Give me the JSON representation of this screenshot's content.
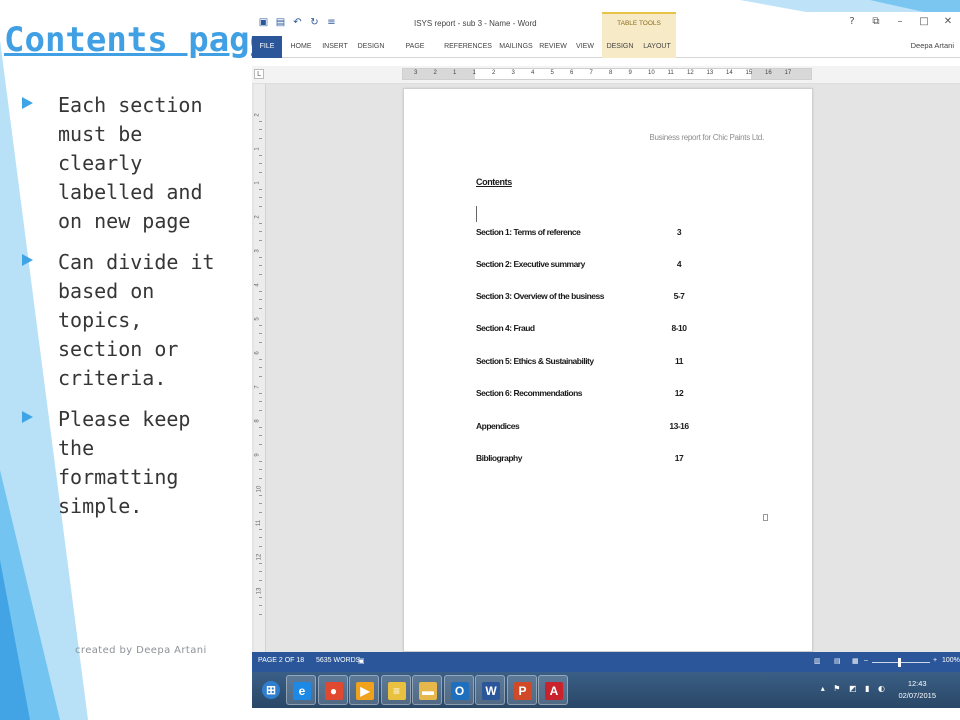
{
  "slide": {
    "title": "Contents page",
    "bullets": [
      "Each section\nmust be\nclearly\nlabelled and\non new page",
      "Can divide it\nbased on\ntopics,\nsection or\ncriteria.",
      "Please keep\nthe\nformatting\nsimple."
    ],
    "credit": "created by Deepa Artani"
  },
  "word": {
    "doc_title": "ISYS report - sub 3 - Name - Word",
    "table_tools_label": "TABLE TOOLS",
    "user_name": "Deepa Artani",
    "window_controls": [
      "?",
      "⧉",
      "–",
      "□",
      "✕"
    ],
    "tabs": [
      "FILE",
      "HOME",
      "INSERT",
      "DESIGN",
      "PAGE LAYOUT",
      "REFERENCES",
      "MAILINGS",
      "REVIEW",
      "VIEW",
      "DESIGN",
      "LAYOUT"
    ],
    "ruler_numbers": [
      "3",
      "2",
      "1",
      "1",
      "2",
      "3",
      "4",
      "5",
      "6",
      "7",
      "8",
      "9",
      "10",
      "11",
      "12",
      "13",
      "14",
      "15",
      "16",
      "17"
    ],
    "vruler_numbers": [
      "2",
      "1",
      "1",
      "2",
      "3",
      "4",
      "5",
      "6",
      "7",
      "8",
      "9",
      "10",
      "11",
      "12",
      "13"
    ],
    "page": {
      "header": "Business report for Chic Paints Ltd.",
      "contents_heading": "Contents",
      "toc": [
        {
          "label": "Section 1: Terms of reference",
          "page": "3"
        },
        {
          "label": "Section 2: Executive summary",
          "page": "4"
        },
        {
          "label": "Section 3: Overview of the business",
          "page": "5-7"
        },
        {
          "label": "Section 4: Fraud",
          "page": "8-10"
        },
        {
          "label": "Section 5: Ethics & Sustainability",
          "page": "11"
        },
        {
          "label": "Section 6: Recommendations",
          "page": "12"
        },
        {
          "label": "Appendices",
          "page": "13-16"
        },
        {
          "label": "Bibliography",
          "page": "17"
        }
      ]
    },
    "status": {
      "page_info": "PAGE 2 OF 18",
      "word_count": "5635 WORDS",
      "zoom": "100%"
    },
    "taskbar": {
      "apps": [
        {
          "name": "start",
          "glyph": "⊞",
          "color": "#2f7fd1"
        },
        {
          "name": "internet-explorer",
          "glyph": "e",
          "color": "#1e88e5"
        },
        {
          "name": "chrome",
          "glyph": "●",
          "color": "#e0492f"
        },
        {
          "name": "media-player",
          "glyph": "▶",
          "color": "#f0a21c"
        },
        {
          "name": "notes",
          "glyph": "≡",
          "color": "#e8c23e"
        },
        {
          "name": "folder",
          "glyph": "▬",
          "color": "#e6b84b"
        },
        {
          "name": "outlook",
          "glyph": "O",
          "color": "#1f6fbf"
        },
        {
          "name": "word",
          "glyph": "W",
          "color": "#2b579a"
        },
        {
          "name": "powerpoint",
          "glyph": "P",
          "color": "#d04a28"
        },
        {
          "name": "acrobat",
          "glyph": "A",
          "color": "#c8232c"
        }
      ],
      "time": "12:43",
      "date": "02/07/2015"
    }
  },
  "colors": {
    "title_blue": "#41a0e3",
    "accent_blue": "#3fa4e6",
    "word_blue": "#2b579a",
    "table_tools_gold": "#f7eac7"
  }
}
